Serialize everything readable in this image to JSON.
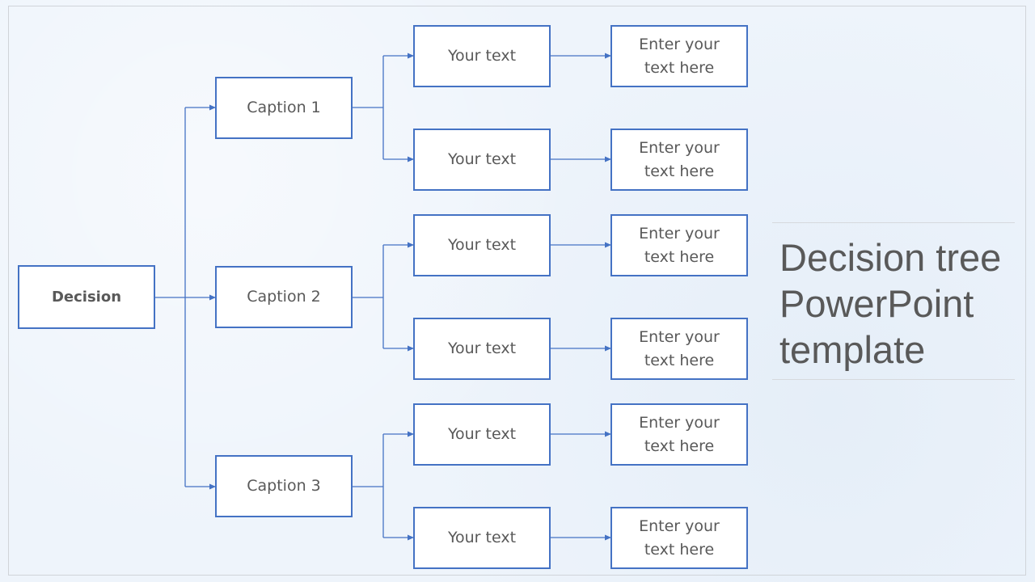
{
  "colors": {
    "box_border": "#4472c4",
    "connector": "#4472c4",
    "text": "#595959",
    "background": "#eef4fb"
  },
  "title": "Decision tree\nPowerPoint\ntemplate",
  "tree": {
    "root": "Decision",
    "captions": [
      "Caption 1",
      "Caption 2",
      "Caption 3"
    ],
    "options": [
      "Your text",
      "Your text",
      "Your text",
      "Your text",
      "Your text",
      "Your text"
    ],
    "outcomes": [
      "Enter your\ntext here",
      "Enter your\ntext here",
      "Enter your\ntext here",
      "Enter your\ntext here",
      "Enter your\ntext here",
      "Enter your\ntext here"
    ]
  }
}
